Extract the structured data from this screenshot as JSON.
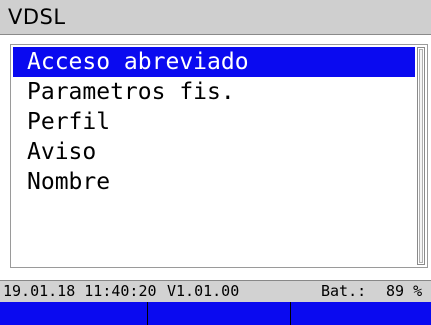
{
  "header": {
    "title": "VDSL"
  },
  "menu": {
    "items": [
      {
        "label": "Acceso abreviado",
        "selected": true
      },
      {
        "label": "Parametros fis.",
        "selected": false
      },
      {
        "label": "Perfil",
        "selected": false
      },
      {
        "label": "Aviso",
        "selected": false
      },
      {
        "label": "Nombre",
        "selected": false
      }
    ]
  },
  "status": {
    "datetime": "19.01.18 11:40:20",
    "version": "V1.01.00",
    "battery_label": "Bat.:",
    "battery_value": "89 %"
  },
  "softkeys": [
    {
      "label": ""
    },
    {
      "label": ""
    },
    {
      "label": ""
    }
  ],
  "colors": {
    "selection": "#0a0af0",
    "softkey_bar": "#0a0af0",
    "title_bar": "#cfcfcf",
    "status_bar": "#d2d2d2"
  }
}
